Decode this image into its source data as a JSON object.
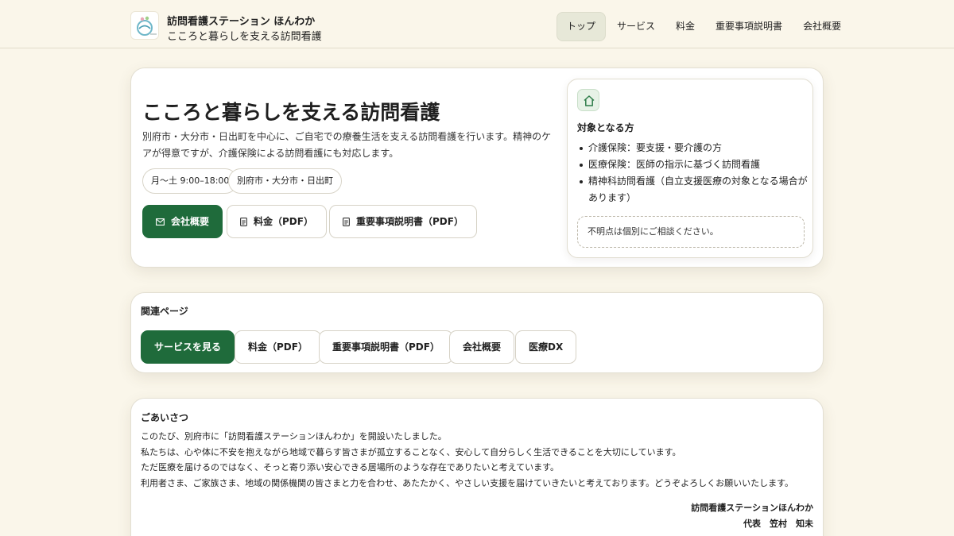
{
  "header": {
    "brand_name": "訪問看護ステーション ほんわか",
    "brand_sub": "こころと暮らしを支える訪問看護",
    "nav": [
      {
        "label": "トップ"
      },
      {
        "label": "サービス"
      },
      {
        "label": "料金"
      },
      {
        "label": "重要事項説明書"
      },
      {
        "label": "会社概要"
      }
    ]
  },
  "hero": {
    "title": "こころと暮らしを支える訪問看護",
    "description": "別府市・大分市・日出町を中心に、ご自宅での療養生活を支える訪問看護を行います。精神のケアが得意ですが、介護保険による訪問看護にも対応します。",
    "pills": [
      "月〜土 9:00–18:00",
      "別府市・大分市・日出町"
    ],
    "buttons": {
      "company": "会社概要",
      "price": "料金（PDF）",
      "important": "重要事項説明書（PDF）"
    },
    "target": {
      "title": "対象となる方",
      "items": [
        "介護保険：要支援・要介護の方",
        "医療保険：医師の指示に基づく訪問看護",
        "精神科訪問看護（自立支援医療の対象となる場合があります）"
      ],
      "note": "不明点は個別にご相談ください。"
    }
  },
  "related": {
    "title": "関連ページ",
    "buttons": [
      "サービスを見る",
      "料金（PDF）",
      "重要事項説明書（PDF）",
      "会社概要",
      "医療DX"
    ]
  },
  "greeting": {
    "title": "ごあいさつ",
    "lines": [
      "このたび、別府市に「訪問看護ステーションほんわか」を開設いたしました。",
      "私たちは、心や体に不安を抱えながら地域で暮らす皆さまが孤立することなく、安心して自分らしく生活できることを大切にしています。",
      "ただ医療を届けるのではなく、そっと寄り添い安心できる居場所のような存在でありたいと考えています。",
      "利用者さま、ご家族さま、地域の関係機関の皆さまと力を合わせ、あたたかく、やさしい支援を届けていきたいと考えております。どうぞよろしくお願いいたします。"
    ],
    "signature_org": "訪問看護ステーションほんわか",
    "signature_name": "代表　笠村　知未"
  },
  "colors": {
    "background": "#faf6ea",
    "primary": "#1f6b3b",
    "card": "#ffffff"
  }
}
